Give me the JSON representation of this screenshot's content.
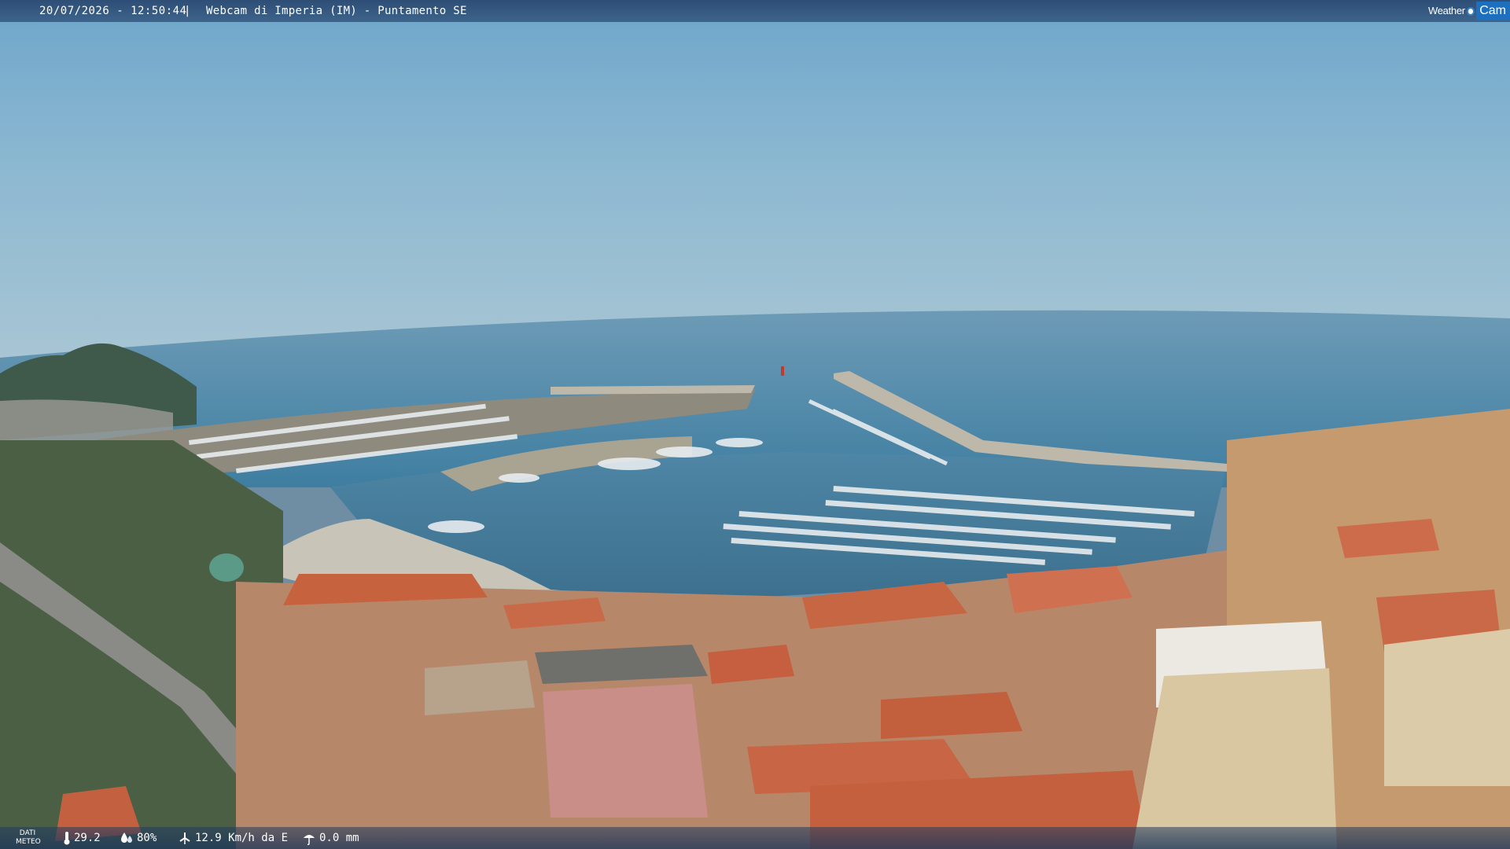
{
  "overlay": {
    "datetime": "20/07/2026 - 12:50:44",
    "separator": "|",
    "title": "Webcam di Imperia (IM) - Puntamento SE",
    "logo": {
      "weather": "Weather",
      "cam": "Cam"
    }
  },
  "weather": {
    "label_line1": "DATI",
    "label_line2": "METEO",
    "temperature": "29.2",
    "humidity": "80%",
    "wind": "12.9 Km/h da E",
    "rain": "0.0 mm",
    "icons": [
      "thermometer-icon",
      "humidity-icon",
      "wind-icon",
      "rain-icon"
    ]
  },
  "colors": {
    "sky_top": "#7fb0cf",
    "sea": "#4f85a5",
    "roof": "#c96a46",
    "bar": "#2c4f7a"
  }
}
